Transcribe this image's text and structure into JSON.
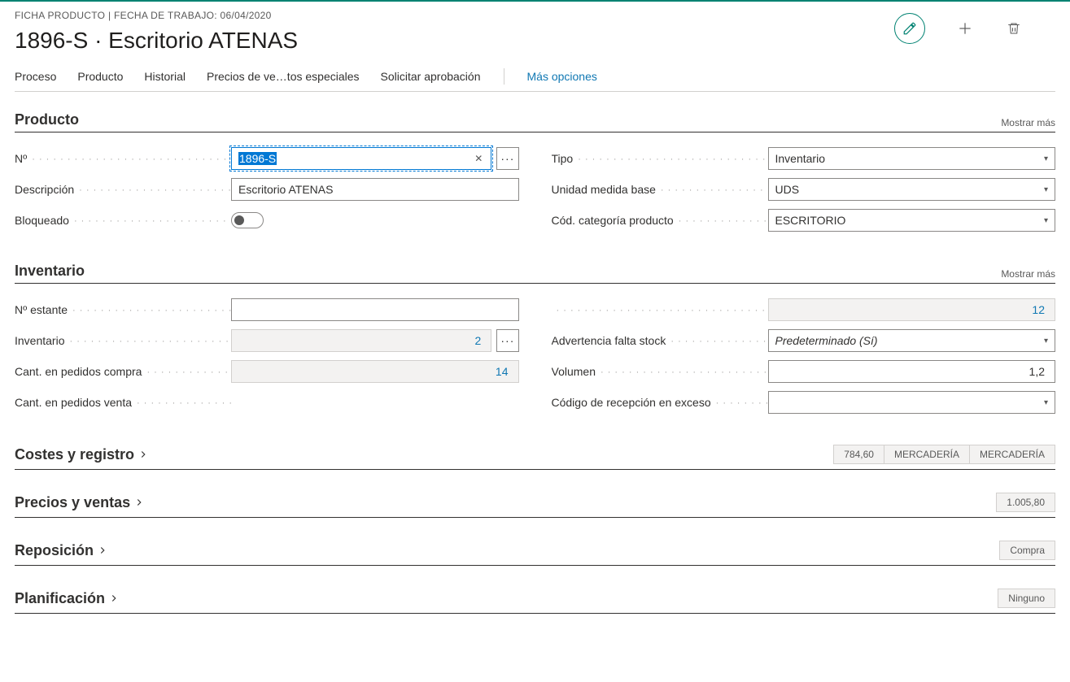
{
  "breadcrumb": "FICHA PRODUCTO | FECHA DE TRABAJO: 06/04/2020",
  "title": "1896-S · Escritorio ATENAS",
  "tabs": {
    "proceso": "Proceso",
    "producto": "Producto",
    "historial": "Historial",
    "precios": "Precios de ve…tos especiales",
    "solicitar": "Solicitar aprobación",
    "mas": "Más opciones"
  },
  "sections": {
    "producto": {
      "title": "Producto",
      "more": "Mostrar más",
      "fields": {
        "no_label": "Nº",
        "no_value": "1896-S",
        "descripcion_label": "Descripción",
        "descripcion_value": "Escritorio ATENAS",
        "bloqueado_label": "Bloqueado",
        "tipo_label": "Tipo",
        "tipo_value": "Inventario",
        "um_label": "Unidad medida base",
        "um_value": "UDS",
        "cat_label": "Cód. categoría producto",
        "cat_value": "ESCRITORIO"
      }
    },
    "inventario": {
      "title": "Inventario",
      "more": "Mostrar más",
      "fields": {
        "estante_label": "Nº estante",
        "estante_value": "",
        "inv_label": "Inventario",
        "inv_value": "2",
        "compra_label": "Cant. en pedidos compra",
        "compra_value": "14",
        "venta_label": "Cant. en pedidos venta",
        "blank_readonly_value": "12",
        "adv_label": "Advertencia falta stock",
        "adv_value": "Predeterminado (Sí)",
        "vol_label": "Volumen",
        "vol_value": "1,2",
        "rec_label": "Código de recepción en exceso",
        "rec_value": ""
      }
    },
    "costes": {
      "title": "Costes y registro",
      "badges": [
        "784,60",
        "MERCADERÍA",
        "MERCADERÍA"
      ]
    },
    "precios": {
      "title": "Precios y ventas",
      "badges": [
        "1.005,80"
      ]
    },
    "reposicion": {
      "title": "Reposición",
      "badges": [
        "Compra"
      ]
    },
    "planificacion": {
      "title": "Planificación",
      "badges": [
        "Ninguno"
      ]
    }
  }
}
